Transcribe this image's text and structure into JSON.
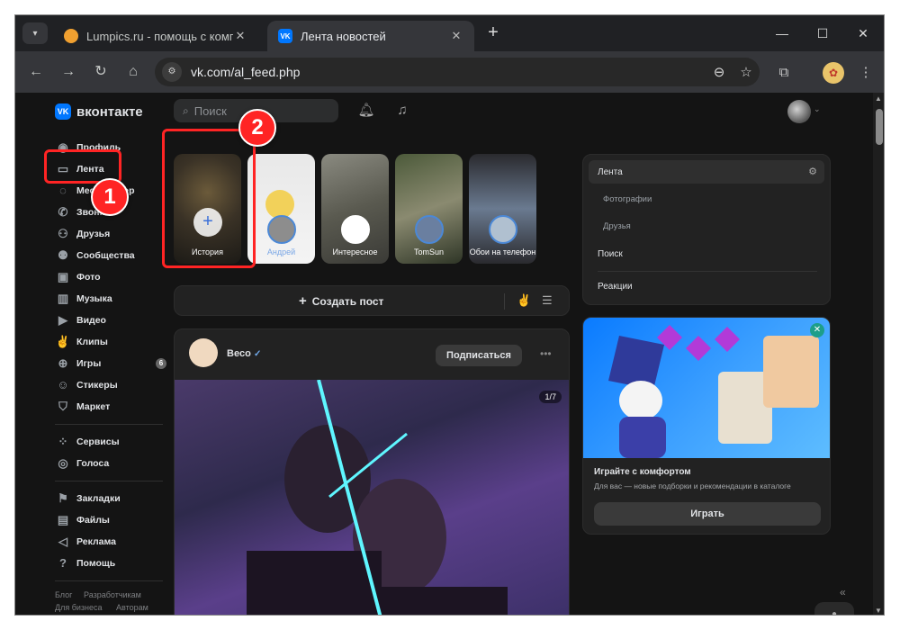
{
  "browser": {
    "tabs": [
      {
        "title": "Lumpics.ru - помощь с компь",
        "close": "✕"
      },
      {
        "title": "Лента новостей",
        "close": "✕"
      }
    ],
    "new_tab": "+",
    "url": "vk.com/al_feed.php"
  },
  "header": {
    "logo_text": "вконтакте",
    "search_placeholder": "Поиск"
  },
  "sidebar": {
    "items": [
      {
        "label": "Профиль",
        "icon": "user-circle-icon"
      },
      {
        "label": "Лента",
        "icon": "feed-icon"
      },
      {
        "label": "Мессенджер",
        "icon": "chat-icon"
      },
      {
        "label": "Звонки",
        "icon": "phone-icon"
      },
      {
        "label": "Друзья",
        "icon": "friends-icon"
      },
      {
        "label": "Сообщества",
        "icon": "community-icon"
      },
      {
        "label": "Фото",
        "icon": "photo-icon"
      },
      {
        "label": "Музыка",
        "icon": "music-icon"
      },
      {
        "label": "Видео",
        "icon": "video-icon"
      },
      {
        "label": "Клипы",
        "icon": "clips-icon"
      },
      {
        "label": "Игры",
        "icon": "gamepad-icon",
        "badge": "6"
      },
      {
        "label": "Стикеры",
        "icon": "sticker-icon"
      },
      {
        "label": "Маркет",
        "icon": "market-icon"
      },
      {
        "label": "Сервисы",
        "icon": "services-icon"
      },
      {
        "label": "Голоса",
        "icon": "votes-icon"
      },
      {
        "label": "Закладки",
        "icon": "bookmark-icon"
      },
      {
        "label": "Файлы",
        "icon": "file-icon"
      },
      {
        "label": "Реклама",
        "icon": "megaphone-icon"
      },
      {
        "label": "Помощь",
        "icon": "help-icon"
      }
    ],
    "footer": [
      "Блог",
      "Разработчикам",
      "Для бизнеса",
      "Авторам"
    ]
  },
  "stories": [
    {
      "label": "История"
    },
    {
      "label": "Андрей"
    },
    {
      "label": "Интересное"
    },
    {
      "label": "TomSun"
    },
    {
      "label": "Обои на телефон"
    }
  ],
  "create_post": {
    "label": "Создать пост"
  },
  "post": {
    "author": "Beco",
    "subscribe": "Подписаться",
    "photo_counter": "1/7"
  },
  "right_menu": {
    "items": [
      {
        "label": "Лента"
      },
      {
        "label": "Фотографии"
      },
      {
        "label": "Друзья"
      },
      {
        "label": "Поиск"
      },
      {
        "label": "Реакции"
      }
    ]
  },
  "promo": {
    "title": "Играйте с комфортом",
    "description": "Для вас — новые подборки и рекомендации в каталоге",
    "button": "Играть"
  },
  "annotations": [
    "1",
    "2"
  ],
  "colors": {
    "accent": "#0077ff",
    "annotation": "#ff2424",
    "background": "#141414"
  }
}
